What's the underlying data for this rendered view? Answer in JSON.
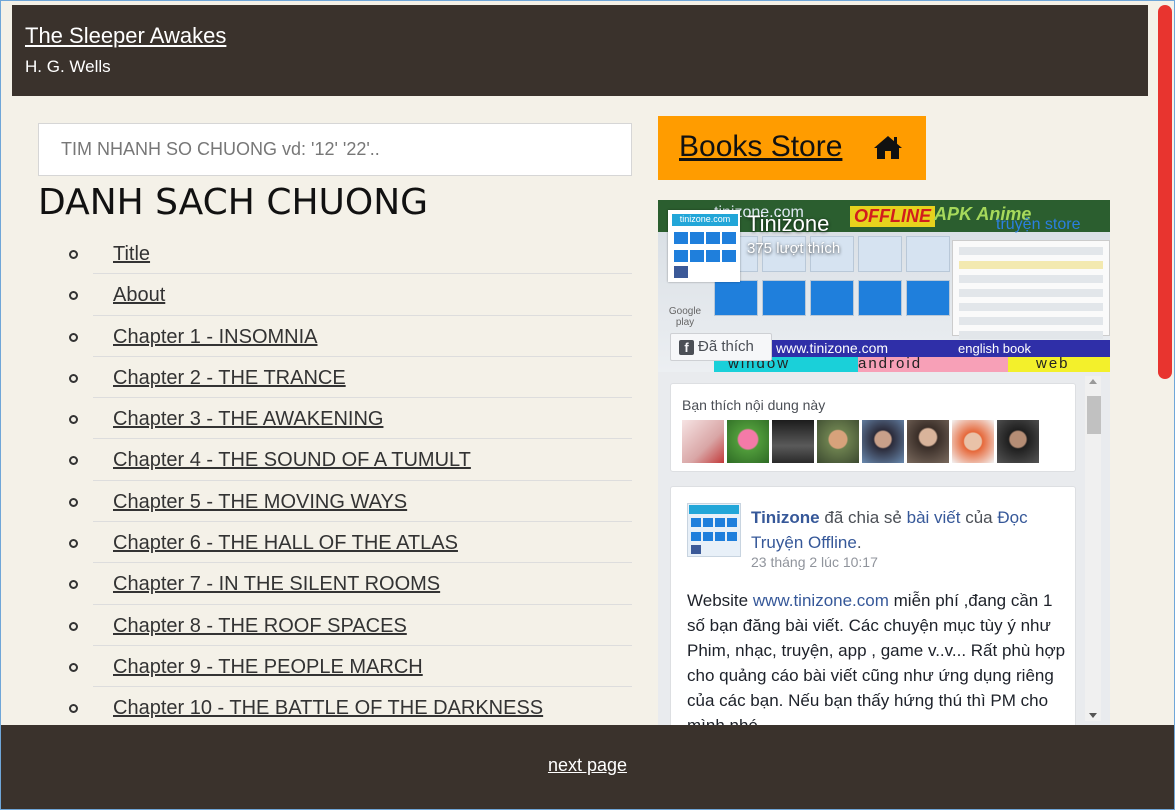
{
  "book": {
    "title": "The Sleeper Awakes",
    "author": "H. G. Wells"
  },
  "search": {
    "placeholder": "TIM NHANH SO CHUONG vd: '12' '22'.."
  },
  "chapter_list": {
    "heading": "DANH SACH CHUONG",
    "items": [
      "Title",
      "About",
      "Chapter 1 - INSOMNIA",
      "Chapter 2 - THE TRANCE",
      "Chapter 3 - THE AWAKENING",
      "Chapter 4 - THE SOUND OF A TUMULT",
      "Chapter 5 - THE MOVING WAYS",
      "Chapter 6 - THE HALL OF THE ATLAS",
      "Chapter 7 - IN THE SILENT ROOMS",
      "Chapter 8 - THE ROOF SPACES",
      "Chapter 9 - THE PEOPLE MARCH",
      "Chapter 10 - THE BATTLE OF THE DARKNESS"
    ]
  },
  "store_button": {
    "label": "Books Store",
    "icon": "home-icon",
    "color": "#ff9c00"
  },
  "facebook_widget": {
    "page_name": "Tinizone",
    "like_count": "375 lượt thích",
    "liked_button": "Đã thích",
    "cover": {
      "site": "tinizone.com",
      "offline": "OFFLINE",
      "apk": "APK",
      "anime": "Anime",
      "store": "truyện store",
      "link": "www.tinizone.com",
      "english": "english book",
      "window": "window",
      "android": "android",
      "web": "web",
      "google_play": "Google play"
    },
    "friends_caption": "Bạn thích nội dung này",
    "post": {
      "author": "Tinizone",
      "action": "đã chia sẻ",
      "object": "bài viết",
      "preposition": "của",
      "source": "Đọc Truyện Offline",
      "time": "23 tháng 2 lúc 10:17",
      "body_prefix": "Website",
      "body_link": "www.tinizone.com",
      "body_text": "miễn phí ,đang cần 1 số bạn đăng bài viết. Các chuyện mục tùy ý như Phim, nhạc, truyện, app , game v..v... Rất phù hợp cho quảng cáo bài viết cũng như ứng dụng riêng của các bạn. Nếu bạn thấy hứng thú thì PM cho mình nhé"
    }
  },
  "footer": {
    "next_label": "next page"
  },
  "colors": {
    "header_bg": "#3a322c",
    "page_bg": "#f4f1e8",
    "fb_link": "#365899",
    "scroll_accent": "#e8342f"
  }
}
